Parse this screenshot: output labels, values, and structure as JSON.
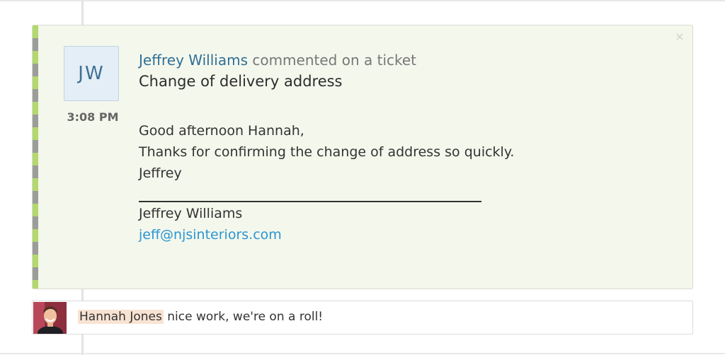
{
  "activity": {
    "avatar_initials": "JW",
    "time": "3:08 PM",
    "author": "Jeffrey Williams",
    "action": "commented on a ticket",
    "subject": "Change of delivery address",
    "close_icon": "close-icon",
    "message_lines": [
      "Good afternoon Hannah,",
      "Thanks for confirming the change of address so quickly.",
      "Jeffrey"
    ],
    "signature_name": "Jeffrey Williams",
    "signature_email": "jeff@njsinteriors.com"
  },
  "reply": {
    "mention": "Hannah Jones",
    "text": " nice work, we're on a roll!"
  },
  "colors": {
    "card_background": "#f4f7ec",
    "author_link": "#2f6f95",
    "email_link": "#2a96d2",
    "stripe_green": "#a9d25a",
    "mention_highlight": "#f8e3d3"
  }
}
